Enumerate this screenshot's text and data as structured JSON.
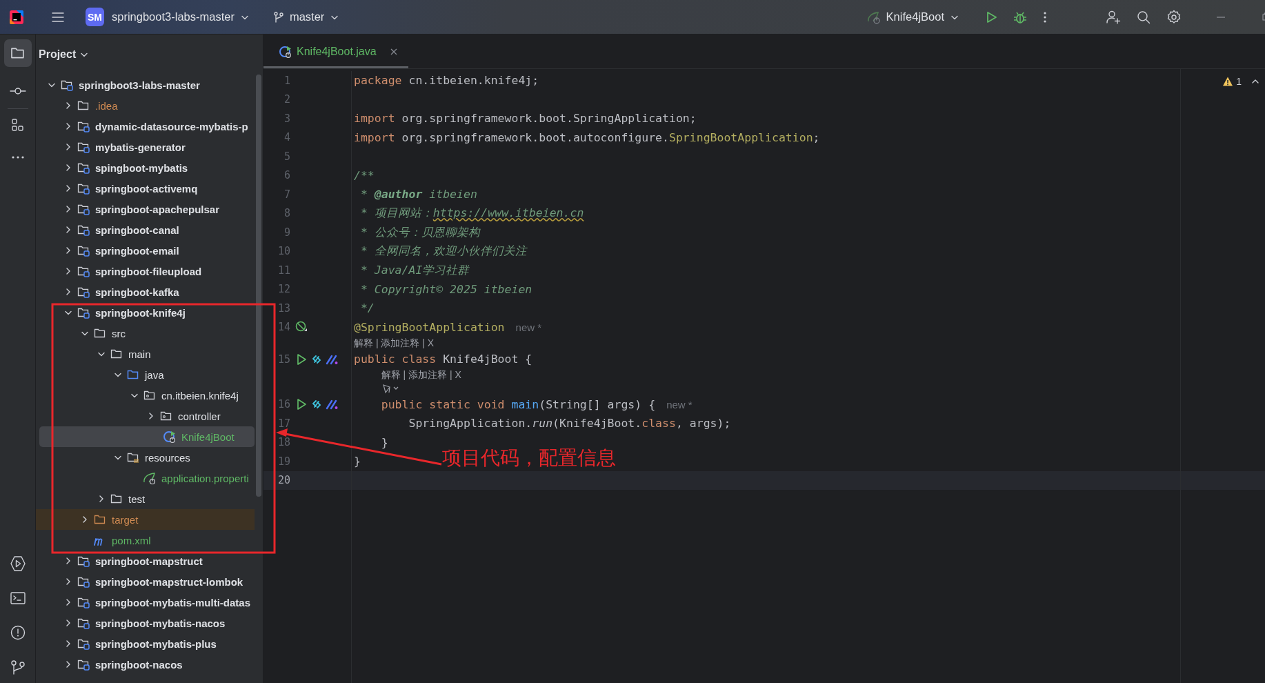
{
  "title_bar": {
    "project_badge": "SM",
    "project": "springboot3-labs-master",
    "branch": "master",
    "run_config": "Knife4jBoot"
  },
  "project_panel": {
    "title": "Project",
    "tree": [
      {
        "label": "springboot3-labs-master",
        "kind": "module",
        "expanded": true,
        "selected": false,
        "children": [
          {
            "label": ".idea",
            "kind": "folder",
            "expanded": false,
            "selected": false,
            "color": "#cf8a52"
          },
          {
            "label": "dynamic-datasource-mybatis-p",
            "kind": "module",
            "expanded": false,
            "selected": false
          },
          {
            "label": "mybatis-generator",
            "kind": "module",
            "expanded": false,
            "selected": false
          },
          {
            "label": "spingboot-mybatis",
            "kind": "module",
            "expanded": false,
            "selected": false
          },
          {
            "label": "springboot-activemq",
            "kind": "module",
            "expanded": false,
            "selected": false
          },
          {
            "label": "springboot-apachepulsar",
            "kind": "module",
            "expanded": false,
            "selected": false
          },
          {
            "label": "springboot-canal",
            "kind": "module",
            "expanded": false,
            "selected": false
          },
          {
            "label": "springboot-email",
            "kind": "module",
            "expanded": false,
            "selected": false
          },
          {
            "label": "springboot-fileupload",
            "kind": "module",
            "expanded": false,
            "selected": false
          },
          {
            "label": "springboot-kafka",
            "kind": "module",
            "expanded": false,
            "selected": false
          },
          {
            "label": "springboot-knife4j",
            "kind": "module",
            "expanded": true,
            "selected": false,
            "children": [
              {
                "label": "src",
                "kind": "folder",
                "expanded": true,
                "selected": false,
                "children": [
                  {
                    "label": "main",
                    "kind": "folder",
                    "expanded": true,
                    "selected": false,
                    "children": [
                      {
                        "label": "java",
                        "kind": "source",
                        "expanded": true,
                        "selected": false,
                        "children": [
                          {
                            "label": "cn.itbeien.knife4j",
                            "kind": "package",
                            "expanded": true,
                            "selected": false,
                            "children": [
                              {
                                "label": "controller",
                                "kind": "package",
                                "expanded": false,
                                "selected": false
                              },
                              {
                                "label": "Knife4jBoot",
                                "kind": "class",
                                "selected": true,
                                "color": "#5fb865"
                              }
                            ]
                          }
                        ]
                      },
                      {
                        "label": "resources",
                        "kind": "resources",
                        "expanded": true,
                        "selected": false,
                        "children": [
                          {
                            "label": "application.properti",
                            "kind": "properties",
                            "selected": false,
                            "color": "#5fb865"
                          }
                        ]
                      }
                    ]
                  },
                  {
                    "label": "test",
                    "kind": "folder",
                    "expanded": false,
                    "selected": false
                  }
                ]
              },
              {
                "label": "target",
                "kind": "excluded",
                "expanded": false,
                "selected": false,
                "color": "#cf8a52"
              },
              {
                "label": "pom.xml",
                "kind": "maven",
                "selected": false,
                "color": "#5fb865"
              }
            ]
          },
          {
            "label": "springboot-mapstruct",
            "kind": "module",
            "expanded": false,
            "selected": false
          },
          {
            "label": "springboot-mapstruct-lombok",
            "kind": "module",
            "expanded": false,
            "selected": false
          },
          {
            "label": "springboot-mybatis-multi-datas",
            "kind": "module",
            "expanded": false,
            "selected": false
          },
          {
            "label": "springboot-mybatis-nacos",
            "kind": "module",
            "expanded": false,
            "selected": false
          },
          {
            "label": "springboot-mybatis-plus",
            "kind": "module",
            "expanded": false,
            "selected": false
          },
          {
            "label": "springboot-nacos",
            "kind": "module",
            "expanded": false,
            "selected": false
          }
        ]
      }
    ]
  },
  "editor": {
    "tabs": [
      {
        "label": "Knife4jBoot.java",
        "selected": true,
        "color": "#5fb865"
      }
    ],
    "warning_count": "1",
    "lines": [
      {
        "number": "1",
        "current": false,
        "tokens": [
          {
            "text": "package",
            "kind": "keyword"
          },
          {
            "text": " cn.itbeien.knife4j;",
            "kind": "plain"
          }
        ]
      },
      {
        "number": "2",
        "current": false
      },
      {
        "number": "3",
        "current": false,
        "tokens": [
          {
            "text": "import",
            "kind": "keyword"
          },
          {
            "text": " org.springframework.boot.SpringApplication;",
            "kind": "plain"
          }
        ]
      },
      {
        "number": "4",
        "current": false,
        "tokens": [
          {
            "text": "import",
            "kind": "keyword"
          },
          {
            "text": " org.springframework.boot.autoconfigure.",
            "kind": "plain"
          },
          {
            "text": "SpringBootApplication",
            "kind": "annotation"
          },
          {
            "text": ";",
            "kind": "plain"
          }
        ]
      },
      {
        "number": "5",
        "current": false
      },
      {
        "number": "6",
        "current": false,
        "tokens": [
          {
            "text": "/**",
            "kind": "comment"
          }
        ]
      },
      {
        "number": "7",
        "current": false,
        "tokens": [
          {
            "text": " * ",
            "kind": "comment"
          },
          {
            "text": "@author",
            "kind": "doc-tag"
          },
          {
            "text": " itbeien",
            "kind": "comment"
          }
        ]
      },
      {
        "number": "8",
        "current": false,
        "tokens": [
          {
            "text": " * 项目网站：",
            "kind": "comment"
          },
          {
            "text": "https://www.itbeien.cn",
            "kind": "link"
          }
        ]
      },
      {
        "number": "9",
        "current": false,
        "tokens": [
          {
            "text": " * 公众号：贝恩聊架构",
            "kind": "comment"
          }
        ]
      },
      {
        "number": "10",
        "current": false,
        "tokens": [
          {
            "text": " * 全网同名，欢迎小伙伴们关注",
            "kind": "comment"
          }
        ]
      },
      {
        "number": "11",
        "current": false,
        "tokens": [
          {
            "text": " * Java/AI学习社群",
            "kind": "comment"
          }
        ]
      },
      {
        "number": "12",
        "current": false,
        "tokens": [
          {
            "text": " * Copyright© 2025 itbeien",
            "kind": "comment"
          }
        ]
      },
      {
        "number": "13",
        "current": false,
        "tokens": [
          {
            "text": " */",
            "kind": "comment"
          }
        ]
      },
      {
        "number": "14",
        "current": false,
        "gutter": [
          {
            "kind": "bean"
          }
        ],
        "tokens": [
          {
            "text": "@SpringBootApplication",
            "kind": "annotation"
          }
        ],
        "hint": "new *",
        "after": [
          {
            "kind": "lens",
            "text": "解释 | 添加注释 | X"
          }
        ]
      },
      {
        "number": "15",
        "current": false,
        "gutter": [
          {
            "kind": "run"
          },
          {
            "kind": "link"
          },
          {
            "kind": "marks"
          }
        ],
        "tokens": [
          {
            "text": "public class",
            "kind": "keyword"
          },
          {
            "text": " Knife4jBoot {",
            "kind": "plain"
          }
        ],
        "after": [
          {
            "kind": "lens",
            "text": "解释 | 添加注释 | X"
          },
          {
            "kind": "assistant-menu"
          }
        ]
      },
      {
        "number": "16",
        "current": false,
        "gutter": [
          {
            "kind": "run"
          },
          {
            "kind": "link"
          },
          {
            "kind": "marks"
          }
        ],
        "tokens": [
          {
            "text": "    public static void ",
            "kind": "keyword"
          },
          {
            "text": "main",
            "kind": "method"
          },
          {
            "text": "(String[] args) {",
            "kind": "plain"
          }
        ],
        "hint": "new *"
      },
      {
        "number": "17",
        "current": false,
        "tokens": [
          {
            "text": "        SpringApplication.",
            "kind": "plain"
          },
          {
            "text": "run",
            "kind": "static-call"
          },
          {
            "text": "(Knife4jBoot.",
            "kind": "plain"
          },
          {
            "text": "class",
            "kind": "keyword"
          },
          {
            "text": ", args);",
            "kind": "plain"
          }
        ]
      },
      {
        "number": "18",
        "current": false,
        "tokens": [
          {
            "text": "    }",
            "kind": "plain"
          }
        ]
      },
      {
        "number": "19",
        "current": false,
        "tokens": [
          {
            "text": "}",
            "kind": "plain"
          }
        ]
      },
      {
        "number": "20",
        "current": true
      }
    ]
  },
  "annotation": {
    "text": "项目代码，配置信息"
  }
}
